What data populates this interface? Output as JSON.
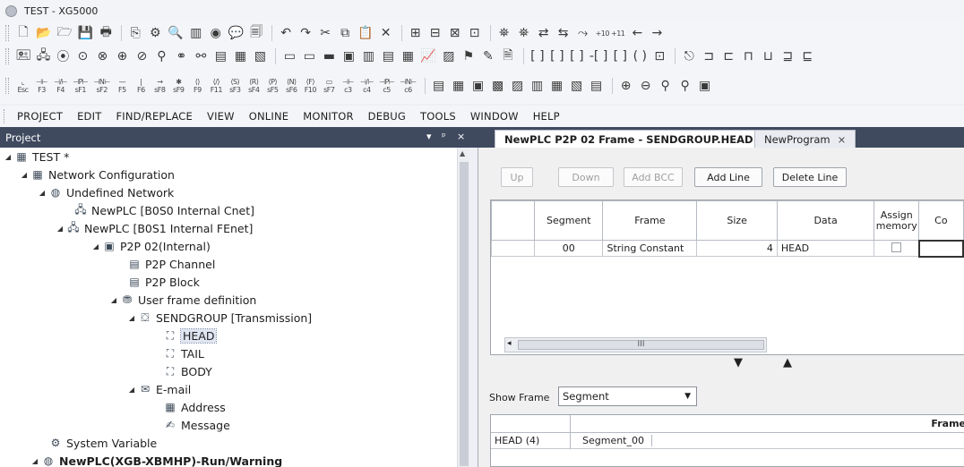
{
  "window": {
    "title": "TEST - XG5000"
  },
  "toolbar1": [
    "new-file",
    "open-folder",
    "open-project",
    "save",
    "print",
    "close-doc",
    "compile",
    "print-preview",
    "monitor",
    "online",
    "comment",
    "find-doc",
    "undo",
    "redo",
    "cut",
    "copy",
    "paste",
    "delete",
    "insert-row",
    "delete-row",
    "insert-col",
    "delete-col",
    "find",
    "find-next",
    "replace",
    "replace-next",
    "goto",
    "increment",
    "back",
    "forward"
  ],
  "toolbar1_labels": {
    "increment": "+10 +11",
    "back": "←",
    "forward": "→"
  },
  "toolbar3_keys": [
    "Esc",
    "F3",
    "F4",
    "sF1",
    "sF2",
    "F5",
    "F6",
    "sF8",
    "sF9",
    "F9",
    "F11",
    "sF3",
    "sF4",
    "sF5",
    "sF6",
    "F10",
    "sF7",
    "c3",
    "c4",
    "c5",
    "c6"
  ],
  "menu": [
    "PROJECT",
    "EDIT",
    "FIND/REPLACE",
    "VIEW",
    "ONLINE",
    "MONITOR",
    "DEBUG",
    "TOOLS",
    "WINDOW",
    "HELP"
  ],
  "project_pane": {
    "title": "Project",
    "controls": {
      "dropdown": "▾",
      "pin": "ᵖ",
      "close": "×"
    },
    "tree": [
      {
        "label": "TEST *",
        "icon": "project-icon",
        "expander": "◢"
      },
      {
        "label": "Network Configuration",
        "icon": "network-config-icon",
        "expander": "◢"
      },
      {
        "label": "Undefined Network",
        "icon": "network-icon",
        "expander": "◢"
      },
      {
        "label": "NewPLC [B0S0 Internal Cnet]",
        "icon": "cnet-icon",
        "expander": ""
      },
      {
        "label": "NewPLC [B0S1 Internal FEnet]",
        "icon": "fenet-icon",
        "expander": "◢"
      },
      {
        "label": "P2P 02(Internal)",
        "icon": "p2p-icon",
        "expander": "◢"
      },
      {
        "label": "P2P Channel",
        "icon": "channel-icon",
        "expander": ""
      },
      {
        "label": "P2P Block",
        "icon": "block-icon",
        "expander": ""
      },
      {
        "label": "User frame definition",
        "icon": "frame-def-icon",
        "expander": "◢"
      },
      {
        "label": "SENDGROUP [Transmission]",
        "icon": "send-group-icon",
        "expander": "◢"
      },
      {
        "label": "HEAD",
        "icon": "head-frame-icon",
        "expander": ""
      },
      {
        "label": "TAIL",
        "icon": "tail-frame-icon",
        "expander": ""
      },
      {
        "label": "BODY",
        "icon": "body-frame-icon",
        "expander": ""
      },
      {
        "label": "E-mail",
        "icon": "email-icon",
        "expander": "◢"
      },
      {
        "label": "Address",
        "icon": "address-icon",
        "expander": ""
      },
      {
        "label": "Message",
        "icon": "message-icon",
        "expander": ""
      },
      {
        "label": "System Variable",
        "icon": "system-variable-icon",
        "expander": ""
      },
      {
        "label": "NewPLC(XGB-XBMHP)-Run/Warning",
        "icon": "plc-icon",
        "expander": "◢"
      }
    ]
  },
  "tabs": [
    {
      "label": "NewPLC P2P 02 Frame - SENDGROUP.HEAD",
      "close": "×"
    },
    {
      "label": "NewProgram",
      "close": "×"
    }
  ],
  "frame_editor": {
    "buttons": {
      "up": "Up",
      "down": "Down",
      "add_bcc": "Add BCC",
      "add_line": "Add Line",
      "delete_line": "Delete Line"
    },
    "columns": [
      "Segment",
      "Frame",
      "Size",
      "Data",
      "Assign memory",
      "Co"
    ],
    "rows": [
      {
        "segment": "00",
        "frame": "String Constant",
        "size": "4",
        "data": "HEAD"
      }
    ],
    "scroll_thumb_label": "III",
    "splitter": {
      "down": "▼",
      "up": "▲"
    },
    "show_frame_label": "Show Frame",
    "show_frame_value": "Segment",
    "bottom_header": "Frame",
    "bottom_row": {
      "name": "HEAD (4)",
      "segment": "Segment_00"
    }
  }
}
